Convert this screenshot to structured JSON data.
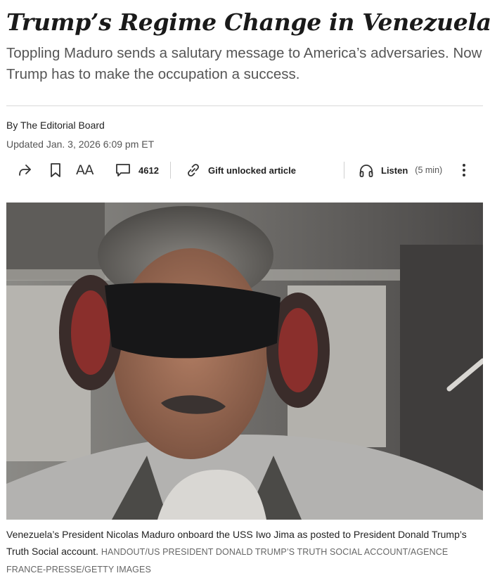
{
  "article": {
    "headline": "Trump’s Regime Change in Venezuela",
    "dek": "Toppling Maduro sends a salutary message to America’s adversaries. Now Trump has to make the occupation a success.",
    "byline_prefix": "By ",
    "author": "The Editorial Board",
    "updated": "Updated Jan. 3, 2026 6:09 pm ET"
  },
  "toolbar": {
    "font_size_label": "AA",
    "comment_count": "4612",
    "gift_label": "Gift unlocked article",
    "listen_label": "Listen",
    "listen_duration": "(5 min)",
    "icons": [
      "share-icon",
      "bookmark-icon",
      "font-size-icon",
      "comment-icon",
      "link-icon",
      "headphones-icon",
      "more-icon"
    ]
  },
  "image": {
    "caption": "Venezuela’s President Nicolas Maduro onboard the USS Iwo Jima as posted to President Donald Trump’s Truth Social account.",
    "credit": "HANDOUT/US PRESIDENT DONALD TRUMP’S TRUTH SOCIAL ACCOUNT/AGENCE FRANCE-PRESSE/GETTY IMAGES"
  },
  "colors": {
    "text": "#222222",
    "dek": "#555555",
    "rule": "#d9d9d9"
  }
}
